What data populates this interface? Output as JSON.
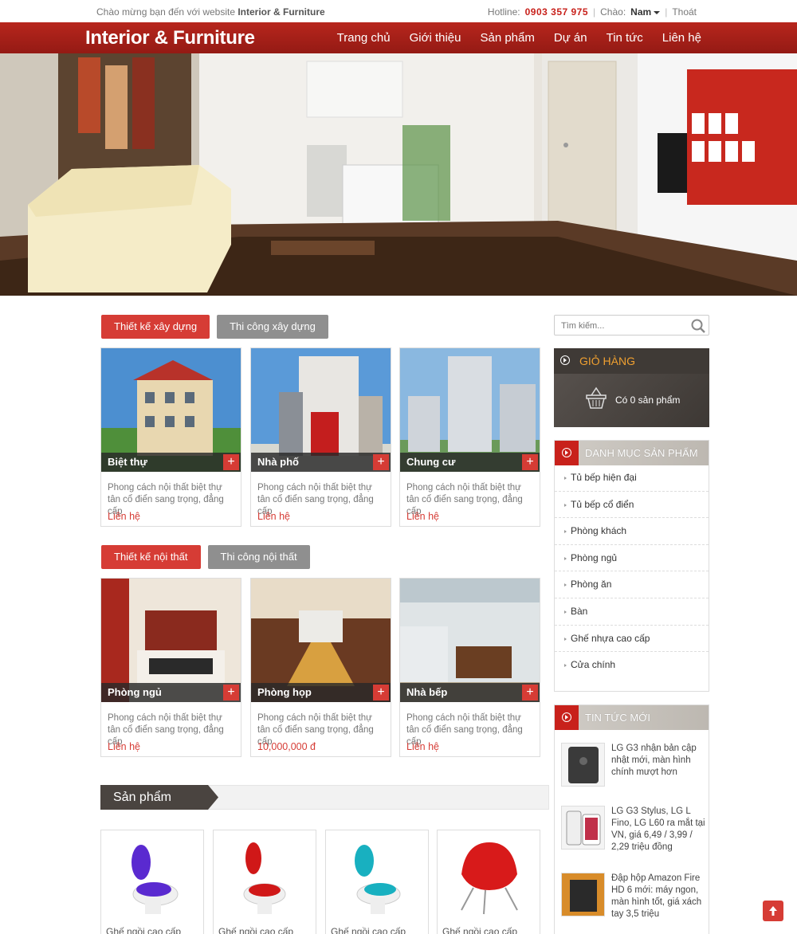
{
  "topbar": {
    "welcome_prefix": "Chào mừng bạn đến với website ",
    "welcome_site": "Interior & Furniture",
    "hotline_label": "Hotline:",
    "hotline_number": "0903 357 975",
    "sep": "|",
    "greeting_label": "Chào:",
    "user_name": "Nam",
    "logout": "Thoát"
  },
  "header": {
    "brand": "Interior & Furniture",
    "nav": [
      "Trang chủ",
      "Giới thiệu",
      "Sản phẩm",
      "Dự án",
      "Tin tức",
      "Liên hệ"
    ]
  },
  "section1": {
    "tabs": [
      "Thiết kế xây dựng",
      "Thi công xây dựng"
    ],
    "cards": [
      {
        "title": "Biệt thự",
        "desc": "Phong cách nội thất biệt thự tân cổ điển sang trọng, đẳng cấp",
        "price": "Liên hệ"
      },
      {
        "title": "Nhà phố",
        "desc": "Phong cách nội thất biệt thự tân cổ điển sang trọng, đẳng cấp",
        "price": "Liên hệ"
      },
      {
        "title": "Chung cư",
        "desc": "Phong cách nội thất biệt thự tân cổ điển sang trọng, đẳng cấp",
        "price": "Liên hệ"
      }
    ]
  },
  "section2": {
    "tabs": [
      "Thiết kế nội thất",
      "Thi công nội thất"
    ],
    "cards": [
      {
        "title": "Phòng ngủ",
        "desc": "Phong cách nội thất biệt thự tân cổ điển sang trọng, đẳng cấp",
        "price": "Liên hệ"
      },
      {
        "title": "Phòng họp",
        "desc": "Phong cách nội thất biệt thự tân cổ điển sang trọng, đẳng cấp",
        "price": "10,000,000 đ"
      },
      {
        "title": "Nhà bếp",
        "desc": "Phong cách nội thất biệt thự tân cổ điển sang trọng, đẳng cấp",
        "price": "Liên hệ"
      }
    ]
  },
  "products": {
    "title": "Sản phẩm",
    "items": [
      {
        "name": "Ghế ngồi cao cấp",
        "color": "#5a2ad0"
      },
      {
        "name": "Ghế ngồi cao cấp",
        "color": "#d01818"
      },
      {
        "name": "Ghế ngồi cao cấp",
        "color": "#18b0c0"
      },
      {
        "name": "Ghế ngồi cao cấp",
        "color": "#d81a1a"
      }
    ]
  },
  "sidebar": {
    "search_placeholder": "Tìm kiếm...",
    "cart_title": "GIỎ HÀNG",
    "cart_count": "Có 0 sản phẩm",
    "categories_title": "DANH MỤC SẢN PHẨM",
    "categories": [
      "Tủ bếp hiện đại",
      "Tủ bếp cổ điển",
      "Phòng khách",
      "Phòng ngủ",
      "Phòng ăn",
      "Bàn",
      "Ghế nhựa cao cấp",
      "Cửa chính"
    ],
    "news_title": "TIN TỨC MỚI",
    "news": [
      "LG G3 nhận bản cập nhật mới, màn hình chính mượt hơn",
      "LG G3 Stylus, LG L Fino, LG L60 ra mắt tại VN, giá 6,49 / 3,99 / 2,29 triệu đồng",
      "Đập hộp Amazon Fire HD 6 mới: máy ngon, màn hình tốt, giá xách tay 3,5 triệu"
    ]
  },
  "colors": {
    "brand_red": "#b7261d",
    "accent_red": "#d63c35",
    "gold": "#f0a030"
  }
}
